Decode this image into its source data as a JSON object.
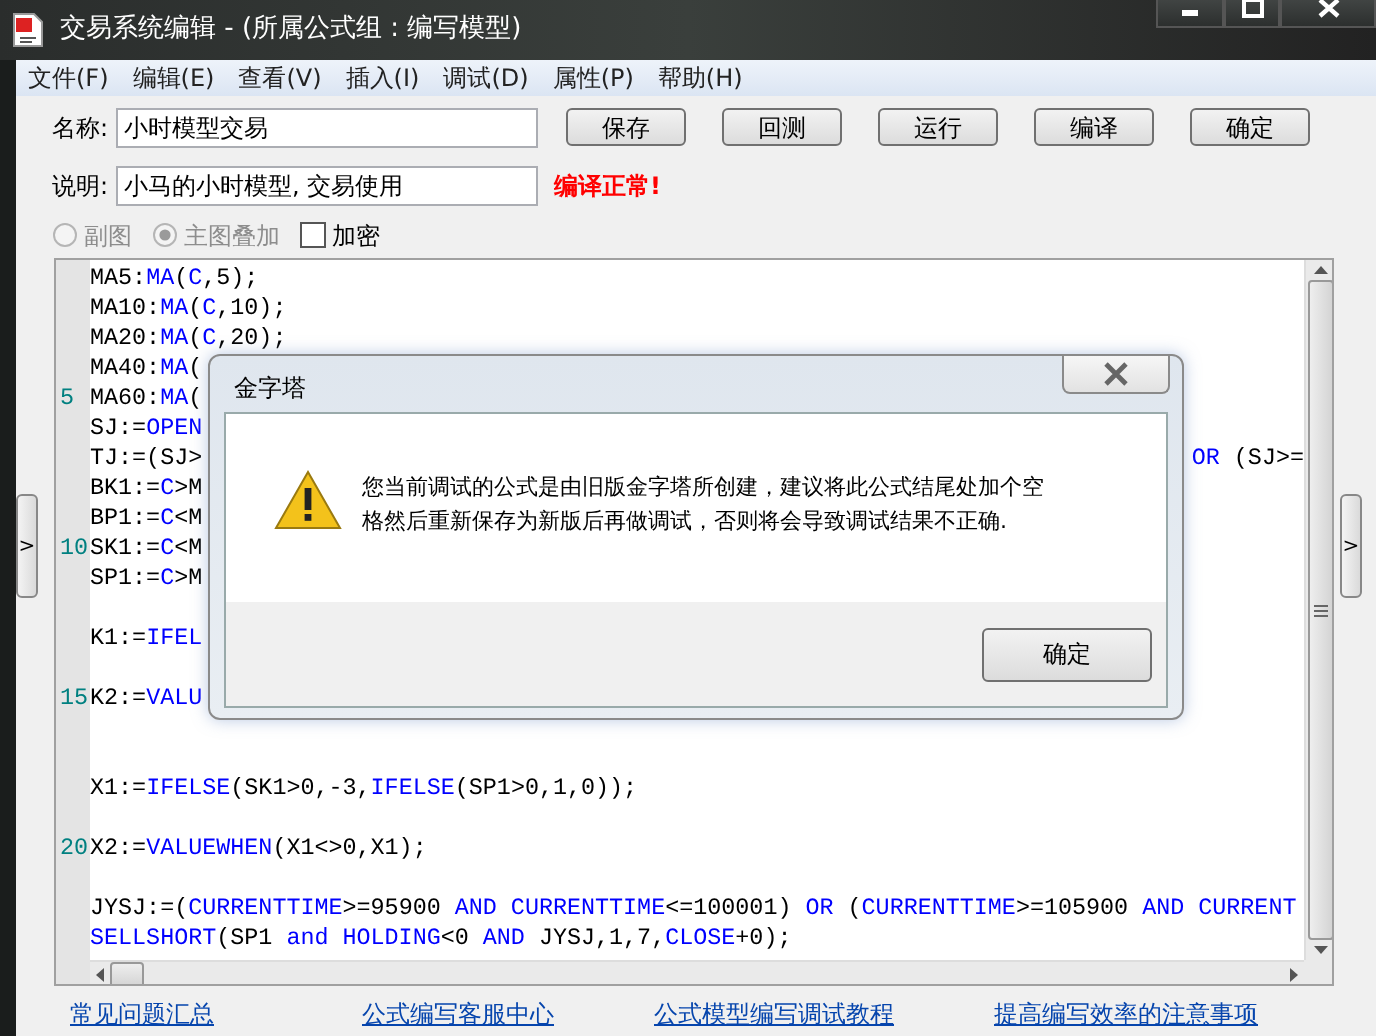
{
  "window": {
    "title": "交易系统编辑 - (所属公式组 : 编写模型)"
  },
  "menu": [
    "文件(F)",
    "编辑(E)",
    "查看(V)",
    "插入(I)",
    "调试(D)",
    "属性(P)",
    "帮助(H)"
  ],
  "form": {
    "name_label": "名称:",
    "name_value": "小时模型交易",
    "desc_label": "说明:",
    "desc_value": "小马的小时模型, 交易使用",
    "status": "编译正常!"
  },
  "buttons": [
    "保存",
    "回测",
    "运行",
    "编译",
    "确定"
  ],
  "options": [
    {
      "kind": "radio",
      "label": "副图",
      "selected": false,
      "disabled": true
    },
    {
      "kind": "radio",
      "label": "主图叠加",
      "selected": true,
      "disabled": true
    },
    {
      "kind": "checkbox",
      "label": "加密",
      "checked": false
    }
  ],
  "side_toggles": [
    ">",
    ">"
  ],
  "code_lines": [
    {
      "kind": "code",
      "segments": [
        {
          "text": "MA5:",
          "kind": "plain"
        },
        {
          "text": "MA",
          "kind": "keyword"
        },
        {
          "text": "(",
          "kind": "plain"
        },
        {
          "text": "C",
          "kind": "keyword"
        },
        {
          "text": ",5);",
          "kind": "plain"
        }
      ]
    },
    {
      "kind": "code",
      "segments": [
        {
          "text": "MA10:",
          "kind": "plain"
        },
        {
          "text": "MA",
          "kind": "keyword"
        },
        {
          "text": "(",
          "kind": "plain"
        },
        {
          "text": "C",
          "kind": "keyword"
        },
        {
          "text": ",10);",
          "kind": "plain"
        }
      ]
    },
    {
      "kind": "code",
      "segments": [
        {
          "text": "MA20:",
          "kind": "plain"
        },
        {
          "text": "MA",
          "kind": "keyword"
        },
        {
          "text": "(",
          "kind": "plain"
        },
        {
          "text": "C",
          "kind": "keyword"
        },
        {
          "text": ",20);",
          "kind": "plain"
        }
      ]
    },
    {
      "kind": "code",
      "segments": [
        {
          "text": "MA40:",
          "kind": "plain"
        },
        {
          "text": "MA",
          "kind": "keyword"
        },
        {
          "text": "(",
          "kind": "plain"
        }
      ]
    },
    {
      "kind": "code",
      "number": "5",
      "segments": [
        {
          "text": "MA60:",
          "kind": "plain"
        },
        {
          "text": "MA",
          "kind": "keyword"
        },
        {
          "text": "(",
          "kind": "plain"
        }
      ]
    },
    {
      "kind": "code",
      "segments": [
        {
          "text": "SJ:=",
          "kind": "plain"
        },
        {
          "text": "OPEN",
          "kind": "keyword"
        }
      ]
    },
    {
      "kind": "code",
      "segments": [
        {
          "text": "TJ:=(SJ>",
          "kind": "plain"
        }
      ],
      "right_segments": [
        {
          "text": "OR",
          "kind": "keyword"
        },
        {
          "text": " (SJ>=",
          "kind": "plain"
        }
      ]
    },
    {
      "kind": "code",
      "segments": [
        {
          "text": "BK1:=",
          "kind": "plain"
        },
        {
          "text": "C",
          "kind": "keyword"
        },
        {
          "text": ">M",
          "kind": "plain"
        }
      ]
    },
    {
      "kind": "code",
      "segments": [
        {
          "text": "BP1:=",
          "kind": "plain"
        },
        {
          "text": "C",
          "kind": "keyword"
        },
        {
          "text": "<M",
          "kind": "plain"
        }
      ]
    },
    {
      "kind": "code",
      "number": "10",
      "segments": [
        {
          "text": "SK1:=",
          "kind": "plain"
        },
        {
          "text": "C",
          "kind": "keyword"
        },
        {
          "text": "<M",
          "kind": "plain"
        }
      ]
    },
    {
      "kind": "code",
      "segments": [
        {
          "text": "SP1:=",
          "kind": "plain"
        },
        {
          "text": "C",
          "kind": "keyword"
        },
        {
          "text": ">M",
          "kind": "plain"
        }
      ]
    },
    {
      "kind": "blank"
    },
    {
      "kind": "code",
      "segments": [
        {
          "text": "K1:=",
          "kind": "plain"
        },
        {
          "text": "IFEL",
          "kind": "keyword"
        }
      ]
    },
    {
      "kind": "blank"
    },
    {
      "kind": "code",
      "number": "15",
      "segments": [
        {
          "text": "K2:=",
          "kind": "plain"
        },
        {
          "text": "VALU",
          "kind": "keyword"
        }
      ]
    },
    {
      "kind": "blank"
    },
    {
      "kind": "blank"
    },
    {
      "kind": "code",
      "segments": [
        {
          "text": "X1:=",
          "kind": "plain"
        },
        {
          "text": "IFELSE",
          "kind": "keyword"
        },
        {
          "text": "(SK1>0,-3,",
          "kind": "plain"
        },
        {
          "text": "IFELSE",
          "kind": "keyword"
        },
        {
          "text": "(SP1>0,1,0));",
          "kind": "plain"
        }
      ]
    },
    {
      "kind": "blank"
    },
    {
      "kind": "code",
      "number": "20",
      "segments": [
        {
          "text": "X2:=",
          "kind": "plain"
        },
        {
          "text": "VALUEWHEN",
          "kind": "keyword"
        },
        {
          "text": "(X1<>0,X1);",
          "kind": "plain"
        }
      ]
    },
    {
      "kind": "blank"
    },
    {
      "kind": "code",
      "segments": [
        {
          "text": "JYSJ:=(",
          "kind": "plain"
        },
        {
          "text": "CURRENTTIME",
          "kind": "keyword"
        },
        {
          "text": ">=95900 ",
          "kind": "plain"
        },
        {
          "text": "AND CURRENTTIME",
          "kind": "keyword"
        },
        {
          "text": "<=100001) ",
          "kind": "plain"
        },
        {
          "text": "OR",
          "kind": "keyword"
        },
        {
          "text": " (",
          "kind": "plain"
        },
        {
          "text": "CURRENTTIME",
          "kind": "keyword"
        },
        {
          "text": ">=105900 ",
          "kind": "plain"
        },
        {
          "text": "AND CURRENT",
          "kind": "keyword"
        }
      ]
    },
    {
      "kind": "code",
      "segments": [
        {
          "text": "SELLSHORT",
          "kind": "keyword"
        },
        {
          "text": "(SP1 ",
          "kind": "plain"
        },
        {
          "text": "and HOLDING",
          "kind": "keyword"
        },
        {
          "text": "<0 ",
          "kind": "plain"
        },
        {
          "text": "AND",
          "kind": "keyword"
        },
        {
          "text": " JYSJ,1,7,",
          "kind": "plain"
        },
        {
          "text": "CLOSE",
          "kind": "keyword"
        },
        {
          "text": "+0);",
          "kind": "plain"
        }
      ]
    }
  ],
  "links": [
    "常见问题汇总",
    "公式编写客服中心",
    "公式模型编写调试教程",
    "提高编写效率的注意事项"
  ],
  "dialog": {
    "title": "金字塔",
    "message_lines": [
      "您当前调试的公式是由旧版金字塔所创建，建议将此公式结尾处加个空",
      "格然后重新保存为新版后再做调试，否则将会导致调试结果不正确."
    ],
    "button": "确定"
  }
}
